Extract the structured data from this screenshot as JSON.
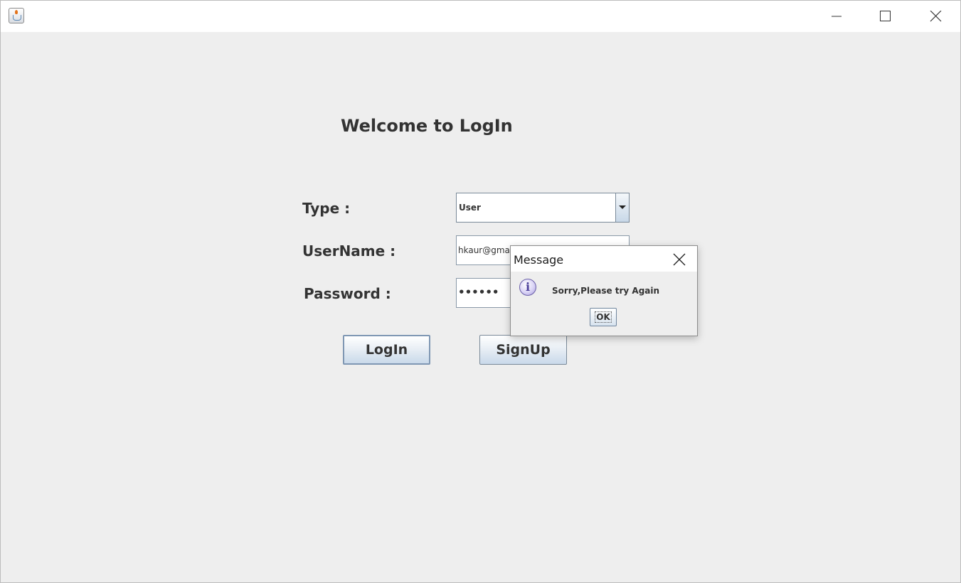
{
  "window": {
    "controls": {
      "minimize": "minimize-icon",
      "maximize": "maximize-icon",
      "close": "close-icon"
    }
  },
  "form": {
    "heading": "Welcome to LogIn",
    "type_label": "Type :",
    "username_label": "UserName :",
    "password_label": "Password :",
    "type_value": "User",
    "username_value": "hkaur@gmail",
    "password_value": "••••••",
    "login_label": "LogIn",
    "signup_label": "SignUp"
  },
  "dialog": {
    "title": "Message",
    "message": "Sorry,Please try Again",
    "ok_label": "OK",
    "icon": "info-icon"
  }
}
